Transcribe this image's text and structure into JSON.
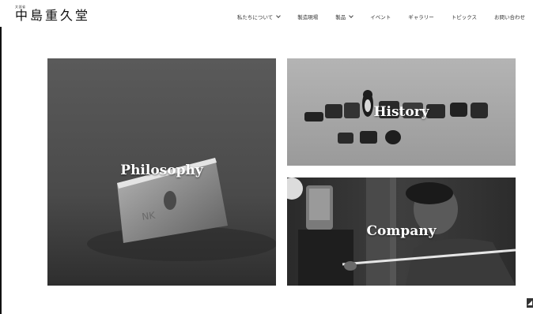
{
  "site": {
    "logo_small": "文部省",
    "logo_main": "中島重久堂"
  },
  "nav": {
    "items": [
      {
        "label": "私たちについて",
        "dropdown": true
      },
      {
        "label": "製造現場",
        "dropdown": false
      },
      {
        "label": "製品",
        "dropdown": true
      },
      {
        "label": "イベント",
        "dropdown": false
      },
      {
        "label": "ギャラリー",
        "dropdown": false
      },
      {
        "label": "トピックス",
        "dropdown": false
      },
      {
        "label": "お問い合わせ",
        "dropdown": false
      }
    ]
  },
  "tiles": {
    "philosophy": "Philosophy",
    "history": "History",
    "company": "Company"
  },
  "colors": {
    "text": "#222222",
    "background": "#ffffff",
    "tile_dark": "#3a3a3a"
  },
  "icons": {
    "nav_dropdown": "chevron-down-icon",
    "corner": "arrow-up-icon"
  }
}
